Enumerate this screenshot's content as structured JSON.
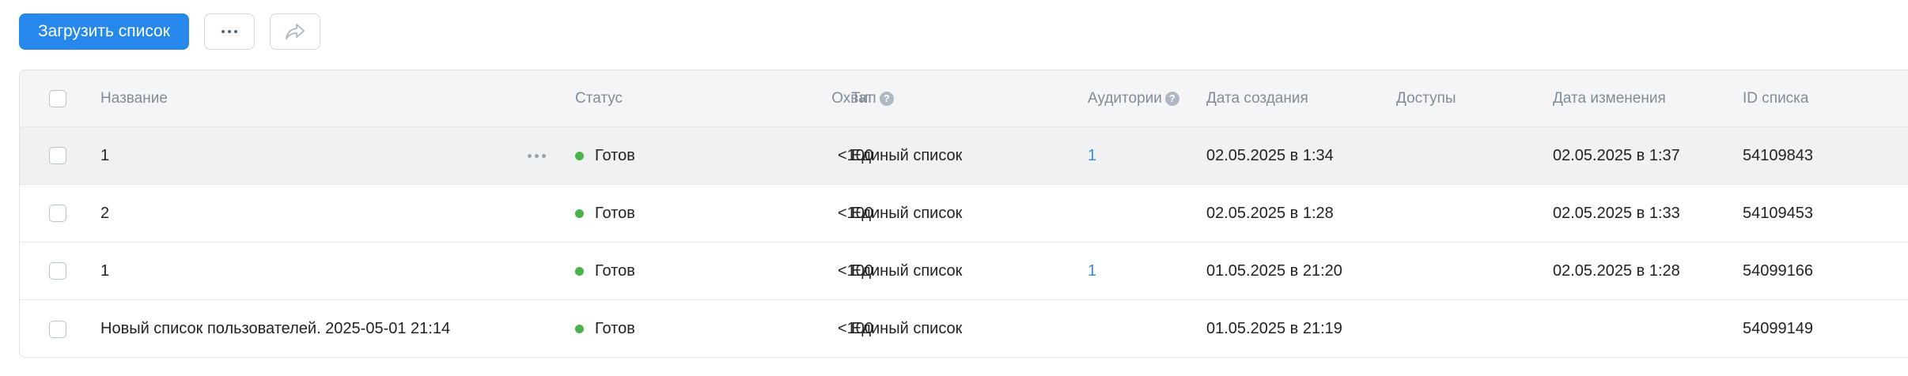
{
  "toolbar": {
    "upload_label": "Загрузить список",
    "more_icon": "more-horizontal-icon",
    "share_icon": "share-icon"
  },
  "table": {
    "columns": {
      "name": "Название",
      "status": "Статус",
      "reach": "Охват",
      "type": "Тип",
      "audiences": "Аудитории",
      "created": "Дата создания",
      "access": "Доступы",
      "modified": "Дата изменения",
      "id": "ID списка"
    },
    "rows": [
      {
        "name": "1",
        "status": "Готов",
        "reach": "<100",
        "type": "Единый список",
        "audiences": "1",
        "created": "02.05.2025 в 1:34",
        "access": "",
        "modified": "02.05.2025 в 1:37",
        "id": "54109843"
      },
      {
        "name": "2",
        "status": "Готов",
        "reach": "<100",
        "type": "Единый список",
        "audiences": "",
        "created": "02.05.2025 в 1:28",
        "access": "",
        "modified": "02.05.2025 в 1:33",
        "id": "54109453"
      },
      {
        "name": "1",
        "status": "Готов",
        "reach": "<100",
        "type": "Единый список",
        "audiences": "1",
        "created": "01.05.2025 в 21:20",
        "access": "",
        "modified": "02.05.2025 в 1:28",
        "id": "54099166"
      },
      {
        "name": "Новый список пользователей. 2025-05-01 21:14",
        "status": "Готов",
        "reach": "<100",
        "type": "Единый список",
        "audiences": "",
        "created": "01.05.2025 в 21:19",
        "access": "",
        "modified": "",
        "id": "54099149"
      }
    ]
  },
  "colors": {
    "primary": "#2688eb",
    "status_ready": "#4bb34b",
    "link": "#3f8ae0",
    "hover_row": "#f0f1f3"
  }
}
